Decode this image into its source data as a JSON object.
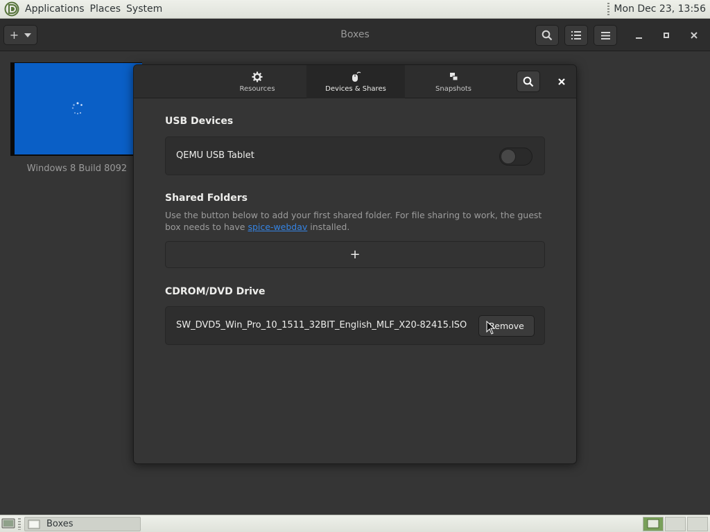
{
  "top_panel": {
    "menus": [
      "Applications",
      "Places",
      "System"
    ],
    "clock": "Mon Dec 23, 13:56"
  },
  "headerbar": {
    "title": "Boxes",
    "new_button_symbol": "+",
    "icons": [
      "add-icon",
      "chevron-down-icon",
      "search-icon",
      "list-view-icon",
      "hamburger-menu-icon",
      "minimize-icon",
      "maximize-icon",
      "close-icon"
    ]
  },
  "background": {
    "vm_name": "Windows 8 Build 8092",
    "vm_screen_color": "#0a5fc6"
  },
  "dialog": {
    "tabs": [
      {
        "label": "Resources",
        "icon": "gear-icon"
      },
      {
        "label": "Devices & Shares",
        "icon": "mouse-icon"
      },
      {
        "label": "Snapshots",
        "icon": "snapshots-icon"
      }
    ],
    "active_tab": "Devices & Shares",
    "usb": {
      "title": "USB Devices",
      "device_name": "QEMU USB Tablet",
      "enabled": false
    },
    "shared_folders": {
      "title": "Shared Folders",
      "help_before": "Use the button below to add your first shared folder. For file sharing to work, the guest box needs to have ",
      "help_link": "spice-webdav",
      "help_after": " installed.",
      "add_symbol": "+"
    },
    "cdrom": {
      "title": "CDROM/DVD Drive",
      "iso_name": "SW_DVD5_Win_Pro_10_1511_32BIT_English_MLF_X20-82415.ISO",
      "remove_label": "Remove"
    }
  },
  "taskbar": {
    "task_label": "Boxes",
    "workspaces": 3,
    "active_workspace": 1,
    "accent": "#79a05a"
  }
}
